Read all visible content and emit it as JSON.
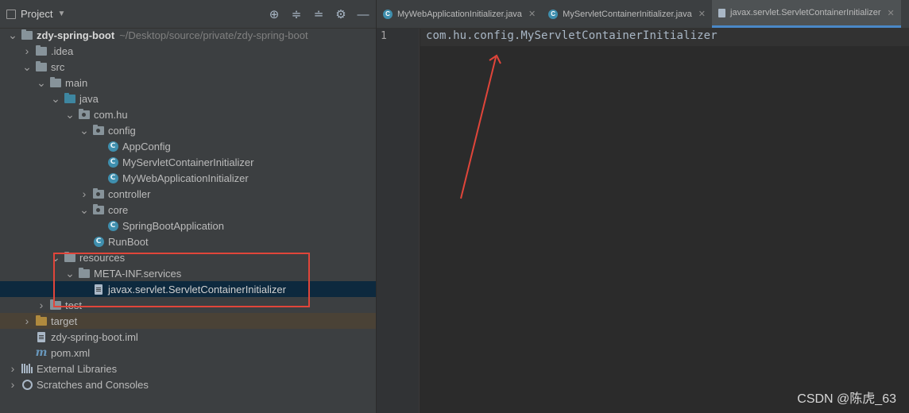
{
  "project_panel": {
    "title": "Project",
    "header_icons": [
      "globe-icon",
      "expand-all-icon",
      "collapse-all-icon",
      "gear-icon",
      "hide-icon"
    ]
  },
  "tree": [
    {
      "label": "zdy-spring-boot",
      "path": "~/Desktop/source/private/zdy-spring-boot",
      "arrow": "down",
      "icon": "module-folder",
      "indent": 0
    },
    {
      "label": ".idea",
      "arrow": "right",
      "icon": "folder",
      "indent": 1
    },
    {
      "label": "src",
      "arrow": "down",
      "icon": "folder",
      "indent": 1
    },
    {
      "label": "main",
      "arrow": "down",
      "icon": "folder",
      "indent": 2
    },
    {
      "label": "java",
      "arrow": "down",
      "icon": "source-folder",
      "indent": 3
    },
    {
      "label": "com.hu",
      "arrow": "down",
      "icon": "package",
      "indent": 4
    },
    {
      "label": "config",
      "arrow": "down",
      "icon": "package",
      "indent": 5
    },
    {
      "label": "AppConfig",
      "arrow": "",
      "icon": "class",
      "indent": 6
    },
    {
      "label": "MyServletContainerInitializer",
      "arrow": "",
      "icon": "class",
      "indent": 6
    },
    {
      "label": "MyWebApplicationInitializer",
      "arrow": "",
      "icon": "class",
      "indent": 6
    },
    {
      "label": "controller",
      "arrow": "right",
      "icon": "package",
      "indent": 5
    },
    {
      "label": "core",
      "arrow": "down",
      "icon": "package",
      "indent": 5
    },
    {
      "label": "SpringBootApplication",
      "arrow": "",
      "icon": "class",
      "indent": 6
    },
    {
      "label": "RunBoot",
      "arrow": "",
      "icon": "class",
      "indent": 5
    },
    {
      "label": "resources",
      "arrow": "down",
      "icon": "resources-folder",
      "indent": 3
    },
    {
      "label": "META-INF.services",
      "arrow": "down",
      "icon": "folder",
      "indent": 4
    },
    {
      "label": "javax.servlet.ServletContainerInitializer",
      "arrow": "",
      "icon": "text-file",
      "indent": 5,
      "selected": true
    },
    {
      "label": "test",
      "arrow": "right",
      "icon": "folder",
      "indent": 2
    },
    {
      "label": "target",
      "arrow": "right",
      "icon": "excluded-folder",
      "indent": 1,
      "excluded": true
    },
    {
      "label": "zdy-spring-boot.iml",
      "arrow": "",
      "icon": "iml-file",
      "indent": 1
    },
    {
      "label": "pom.xml",
      "arrow": "",
      "icon": "maven-file",
      "indent": 1
    },
    {
      "label": "External Libraries",
      "arrow": "right",
      "icon": "libraries",
      "indent": 0
    },
    {
      "label": "Scratches and Consoles",
      "arrow": "right",
      "icon": "scratches",
      "indent": 0
    }
  ],
  "tabs": [
    {
      "label": "MyWebApplicationInitializer.java",
      "icon": "class",
      "active": false
    },
    {
      "label": "MyServletContainerInitializer.java",
      "icon": "class",
      "active": false
    },
    {
      "label": "javax.servlet.ServletContainerInitializer",
      "icon": "text-file",
      "active": true
    }
  ],
  "editor": {
    "line_number": "1",
    "code": "com.hu.config.MyServletContainerInitializer"
  },
  "annotations": {
    "highlight_color": "#e0453a"
  },
  "watermark": "CSDN @陈虎_63"
}
